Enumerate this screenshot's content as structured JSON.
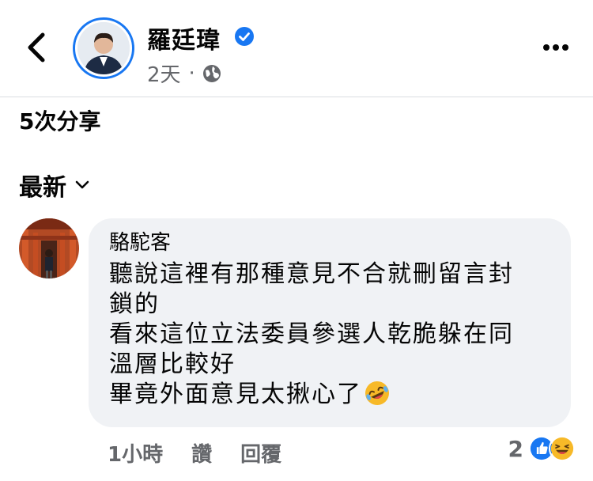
{
  "post": {
    "author": "羅廷瑋",
    "time": "2天",
    "separator": "·"
  },
  "shares": "5次分享",
  "sort": {
    "label": "最新"
  },
  "comment": {
    "name": "駱駝客",
    "lines": [
      "聽說這裡有那種意見不合就刪留言封",
      "鎖的",
      "看來這位立法委員參選人乾脆躲在同",
      "溫層比較好",
      "畢竟外面意見太揪心了"
    ],
    "time": "1小時",
    "like_label": "讚",
    "reply_label": "回覆",
    "reaction_count": "2"
  },
  "colors": {
    "accent": "#1877f2",
    "secondary_text": "#65676b",
    "bubble": "#f0f2f5"
  },
  "icons": {
    "back": "chevron-left-icon",
    "verified": "verified-badge-icon",
    "privacy": "globe-icon",
    "more": "more-dots-icon",
    "sort": "chevron-down-icon",
    "emoji": "rolling-laughing-emoji",
    "reactions": [
      "like-reaction-icon",
      "haha-reaction-icon"
    ]
  }
}
